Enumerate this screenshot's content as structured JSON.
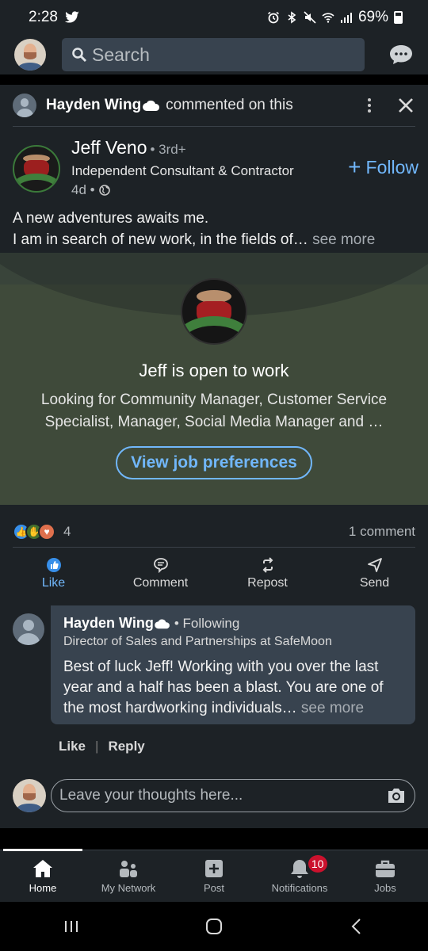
{
  "status_bar": {
    "time": "2:28",
    "battery": "69%"
  },
  "top_bar": {
    "search_placeholder": "Search"
  },
  "context": {
    "name": "Hayden Wing",
    "action": "commented on this"
  },
  "author": {
    "name": "Jeff Veno",
    "degree": "• 3rd+",
    "headline": "Independent Consultant & Contractor",
    "age": "4d •",
    "follow_label": "Follow"
  },
  "post": {
    "line1": "A new adventures awaits me.",
    "line2": "I am in search of new work, in the fields of…",
    "see_more": "see more"
  },
  "open_to_work": {
    "title": "Jeff is open to work",
    "description": "Looking for Community Manager, Customer Service Specialist, Manager, Social Media Manager and …",
    "button_label": "View job preferences"
  },
  "social": {
    "reaction_count": "4",
    "comments": "1 comment"
  },
  "actions": [
    {
      "label": "Like"
    },
    {
      "label": "Comment"
    },
    {
      "label": "Repost"
    },
    {
      "label": "Send"
    }
  ],
  "comment": {
    "name": "Hayden Wing",
    "relation": "• Following",
    "headline": "Director of Sales and Partnerships at SafeMoon",
    "text": "Best of luck Jeff! Working with you over the last year and a half has been a blast. You are one of the most hardworking individuals…",
    "see_more": "see more",
    "like_label": "Like",
    "reply_label": "Reply"
  },
  "compose": {
    "placeholder": "Leave your thoughts here..."
  },
  "bottom_nav": [
    {
      "label": "Home"
    },
    {
      "label": "My Network"
    },
    {
      "label": "Post"
    },
    {
      "label": "Notifications",
      "badge": "10"
    },
    {
      "label": "Jobs"
    }
  ],
  "colors": {
    "accent": "#71b7fb",
    "background": "#1d2226",
    "open_to_work_bg": "#3f4a3a",
    "badge": "#cb112d"
  }
}
